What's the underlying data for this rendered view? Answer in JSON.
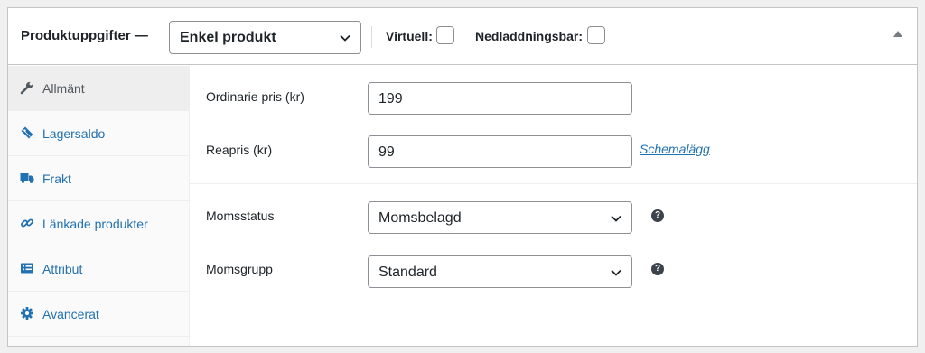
{
  "header": {
    "title": "Produktuppgifter —",
    "product_type": "Enkel produkt",
    "virtual_label": "Virtuell:",
    "downloadable_label": "Nedladdningsbar:"
  },
  "sidebar": {
    "items": [
      {
        "label": "Allmänt",
        "icon": "wrench-icon",
        "active": true
      },
      {
        "label": "Lagersaldo",
        "icon": "tag-icon",
        "active": false
      },
      {
        "label": "Frakt",
        "icon": "truck-icon",
        "active": false
      },
      {
        "label": "Länkade produkter",
        "icon": "link-icon",
        "active": false
      },
      {
        "label": "Attribut",
        "icon": "list-icon",
        "active": false
      },
      {
        "label": "Avancerat",
        "icon": "gear-icon",
        "active": false
      }
    ]
  },
  "general": {
    "regular_price_label": "Ordinarie pris (kr)",
    "regular_price_value": "199",
    "sale_price_label": "Reapris (kr)",
    "sale_price_value": "99",
    "schedule_link": "Schemalägg",
    "tax_status_label": "Momsstatus",
    "tax_status_value": "Momsbelagd",
    "tax_class_label": "Momsgrupp",
    "tax_class_value": "Standard",
    "help_glyph": "?"
  },
  "colors": {
    "accent": "#2271b1",
    "active_tab_bg": "#eeeeee",
    "border": "#c3c4c7"
  }
}
